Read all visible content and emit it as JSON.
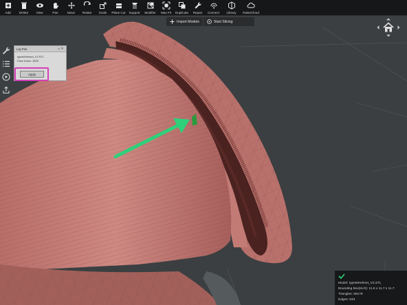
{
  "toolbar": {
    "items": [
      {
        "label": "Add",
        "icon": "add-icon"
      },
      {
        "label": "Delete",
        "icon": "delete-icon"
      },
      {
        "label": "View",
        "icon": "eye-icon"
      },
      {
        "label": "Pan",
        "icon": "hand-icon"
      },
      {
        "label": "Move",
        "icon": "move-icon"
      },
      {
        "label": "Rotate",
        "icon": "rotate-icon"
      },
      {
        "label": "Scale",
        "icon": "scale-icon"
      },
      {
        "label": "Plane Cut",
        "icon": "plane-cut-icon"
      },
      {
        "label": "Support",
        "icon": "support-icon"
      },
      {
        "label": "Modifier",
        "icon": "modifier-icon"
      },
      {
        "label": "Max Fit",
        "icon": "max-fit-icon"
      },
      {
        "label": "Duplicate",
        "icon": "duplicate-icon"
      },
      {
        "label": "Repair",
        "icon": "repair-icon"
      },
      {
        "label": "Connect",
        "icon": "connect-icon"
      },
      {
        "label": "Library",
        "icon": "library-icon"
      },
      {
        "label": "RaiseCloud",
        "icon": "cloud-icon"
      }
    ]
  },
  "subbar": {
    "import_label": "Import Models",
    "slice_label": "Start Slicing"
  },
  "panel": {
    "title": "Lay Flat",
    "model_name": "typeMHelmet_V2.STL",
    "face_index": "Face Index: 1825",
    "apply_label": "Apply"
  },
  "info": {
    "model": "Model: typeMHelmet_V2.STL",
    "bounding_box": "Bounding Box(inch): 11.6 x 11.7 x 11.7",
    "triangles": "Triangles: 80178",
    "edges": "Edges: 533"
  },
  "colors": {
    "model": "#c27a75",
    "highlight": "#d43fb8",
    "arrow": "#2fd07a"
  }
}
